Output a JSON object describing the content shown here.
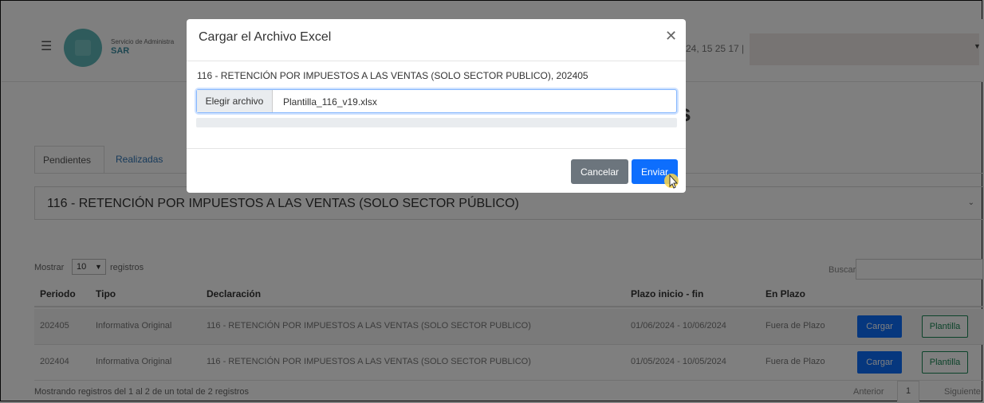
{
  "header": {
    "org_name": "Servicio de Administra",
    "org_short": "SAR",
    "datetime": "24, 15 25 17 |"
  },
  "page": {
    "heading_fragment": "s"
  },
  "tabs": [
    {
      "label": "Pendientes",
      "active": true
    },
    {
      "label": "Realizadas",
      "active": false
    }
  ],
  "declaration_select": {
    "value": "116 - RETENCIÓN POR IMPUESTOS A LAS VENTAS (SOLO SECTOR PÚBLICO)"
  },
  "table": {
    "length_label": "Mostrar",
    "length_value": "10",
    "length_suffix": "registros",
    "search_label": "Buscar",
    "columns": [
      "Periodo",
      "Tipo",
      "Declaración",
      "Plazo inicio - fin",
      "En Plazo"
    ],
    "rows": [
      {
        "periodo": "202405",
        "tipo": "Informativa Original",
        "declaracion": "116 - RETENCIÓN POR IMPUESTOS A LAS VENTAS (SOLO SECTOR PUBLICO)",
        "plazo": "01/06/2024 - 10/06/2024",
        "en_plazo": "Fuera de Plazo",
        "cargar": "Cargar",
        "plantilla": "Plantilla"
      },
      {
        "periodo": "202404",
        "tipo": "Informativa Original",
        "declaracion": "116 - RETENCIÓN POR IMPUESTOS A LAS VENTAS (SOLO SECTOR PUBLICO)",
        "plazo": "01/05/2024 - 10/05/2024",
        "en_plazo": "Fuera de Plazo",
        "cargar": "Cargar",
        "plantilla": "Plantilla"
      }
    ],
    "info": "Mostrando registros del 1 al 2 de un total de 2 registros",
    "pagination": {
      "prev": "Anterior",
      "current": "1",
      "next": "Siguiente"
    }
  },
  "modal": {
    "title": "Cargar el Archivo Excel",
    "description": "116 - RETENCIÓN POR IMPUESTOS A LAS VENTAS (SOLO SECTOR PUBLICO), 202405",
    "file_button": "Elegir archivo",
    "file_name": "Plantilla_116_v19.xlsx",
    "progress": 0,
    "cancel_label": "Cancelar",
    "submit_label": "Enviar"
  },
  "colors": {
    "primary": "#0d6efd",
    "secondary": "#6c757d",
    "success": "#198754",
    "logo": "#5fb7b8"
  },
  "icons": [
    "hamburger-icon",
    "close-icon",
    "chevron-down-icon",
    "cursor-icon"
  ]
}
